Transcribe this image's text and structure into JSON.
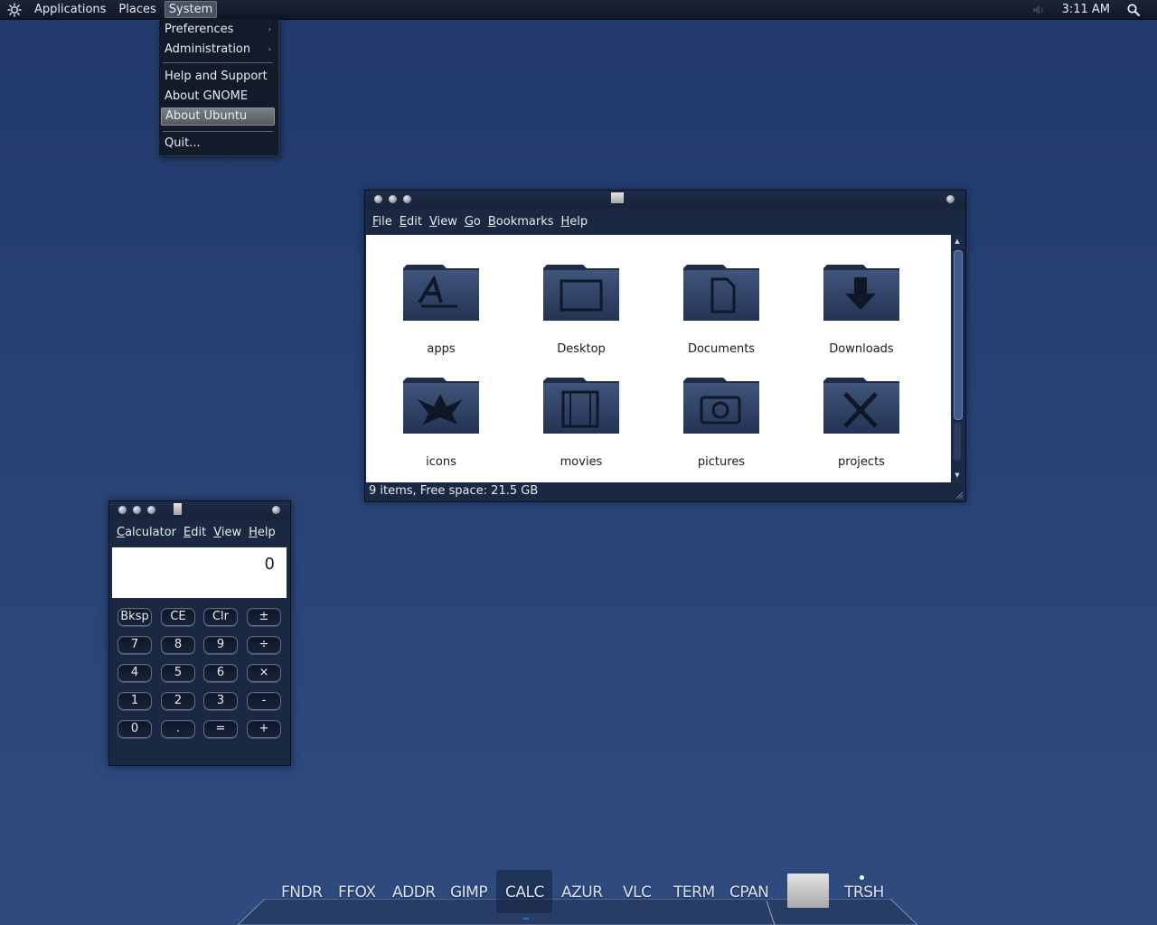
{
  "top_panel": {
    "menus": [
      "Applications",
      "Places",
      "System"
    ],
    "active_menu": "System",
    "clock": "3:11 AM",
    "icons": [
      "gnome-foot-icon",
      "volume-icon",
      "search-icon"
    ]
  },
  "system_menu": {
    "items": [
      {
        "label": "Preferences",
        "submenu": "›"
      },
      {
        "label": "Administration",
        "submenu": "›"
      },
      {
        "label": "Help and Support"
      },
      {
        "label": "About GNOME"
      },
      {
        "label": "About Ubuntu"
      },
      {
        "label": "Quit..."
      }
    ],
    "highlighted": "About Ubuntu"
  },
  "file_manager": {
    "menus": [
      "File",
      "Edit",
      "View",
      "Go",
      "Bookmarks",
      "Help"
    ],
    "mnemonics": [
      "F",
      "E",
      "V",
      "G",
      "B",
      "H"
    ],
    "folders": [
      {
        "name": "apps",
        "icon": "apps-folder-icon"
      },
      {
        "name": "Desktop",
        "icon": "desktop-folder-icon"
      },
      {
        "name": "Documents",
        "icon": "documents-folder-icon"
      },
      {
        "name": "Downloads",
        "icon": "downloads-folder-icon"
      },
      {
        "name": "icons",
        "icon": "icons-folder-icon"
      },
      {
        "name": "movies",
        "icon": "movies-folder-icon"
      },
      {
        "name": "pictures",
        "icon": "pictures-folder-icon"
      },
      {
        "name": "projects",
        "icon": "projects-folder-icon"
      }
    ],
    "status": "9 items, Free space: 21.5 GB"
  },
  "calculator": {
    "menus": [
      "Calculator",
      "Edit",
      "View",
      "Help"
    ],
    "display": "0",
    "buttons": [
      [
        "Bksp",
        "CE",
        "Clr",
        "±"
      ],
      [
        "7",
        "8",
        "9",
        "÷"
      ],
      [
        "4",
        "5",
        "6",
        "×"
      ],
      [
        "1",
        "2",
        "3",
        "-"
      ],
      [
        "0",
        ".",
        "=",
        "+"
      ]
    ]
  },
  "dock": {
    "items": [
      "FNDR",
      "FFOX",
      "ADDR",
      "GIMP",
      "CALC",
      "AZUR",
      "VLC",
      "TERM",
      "CPAN",
      "TRSH"
    ],
    "active": "CALC"
  },
  "colors": {
    "desktop": "#2a4478",
    "panel": "#131b2b",
    "window": "#1a2841",
    "folder": "#2c3d5e"
  }
}
